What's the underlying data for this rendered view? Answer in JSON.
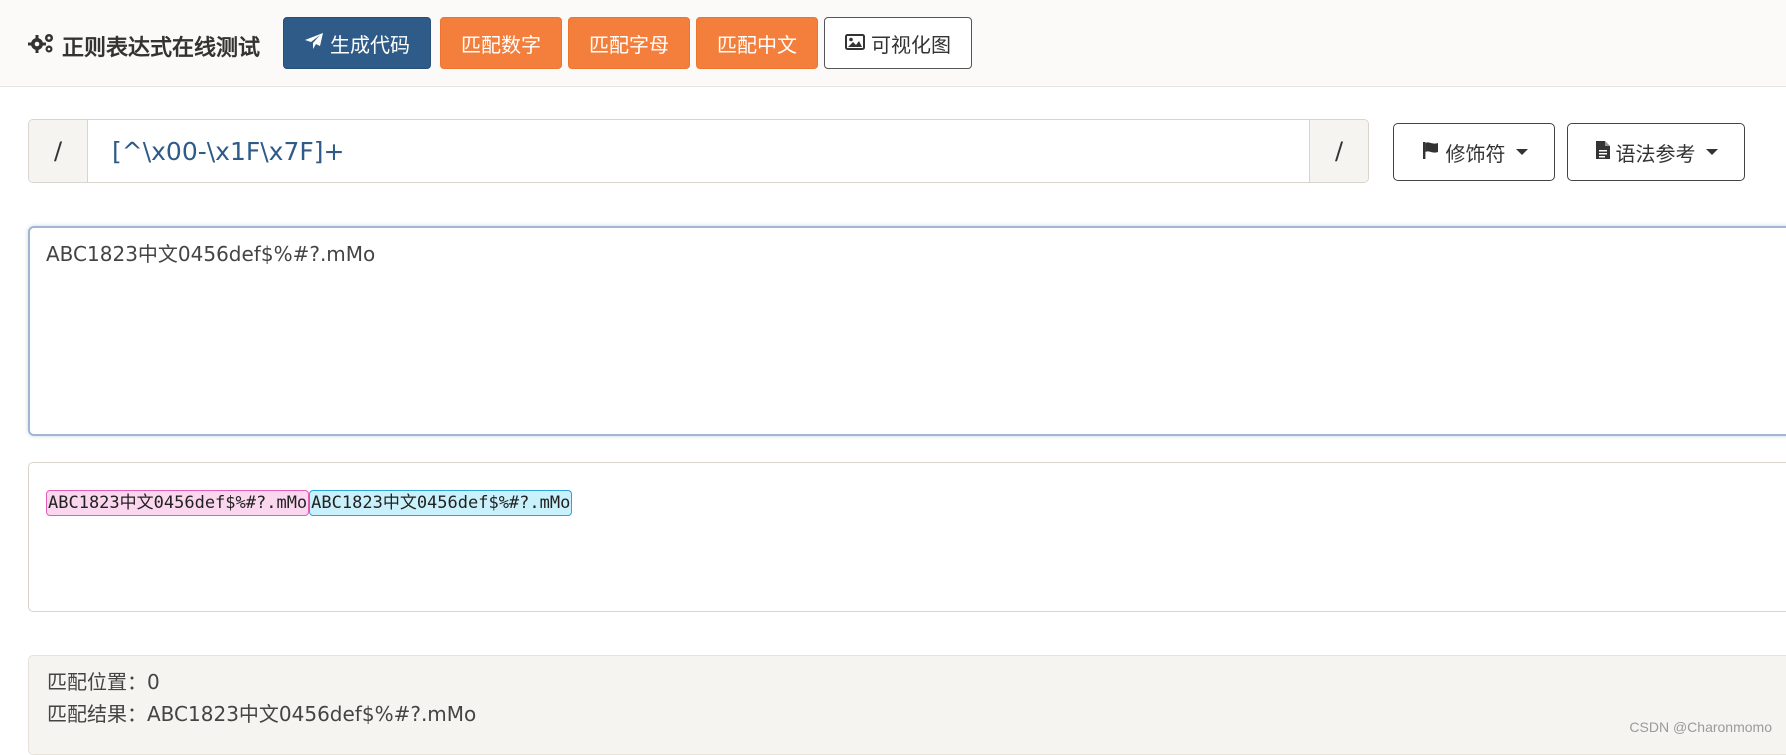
{
  "header": {
    "title": "正则表达式在线测试",
    "buttons": {
      "generate_code": "生成代码",
      "match_digits": "匹配数字",
      "match_letters": "匹配字母",
      "match_chinese": "匹配中文",
      "visualize": "可视化图"
    }
  },
  "regex": {
    "open_delimiter": "/",
    "pattern": "[^\\x00-\\x1F\\x7F]+",
    "close_delimiter": "/",
    "modifiers_label": "修饰符",
    "syntax_reference_label": "语法参考"
  },
  "test_string": "ABC1823中文0456def$%#?.mMo",
  "matches": [
    {
      "text": "ABC1823中文0456def$%#?.mMo",
      "color": "pink"
    },
    {
      "text": "ABC1823中文0456def$%#?.mMo",
      "color": "blue"
    }
  ],
  "result": {
    "position_label": "匹配位置：",
    "position_value": "0",
    "result_label": "匹配结果：",
    "result_value": "ABC1823中文0456def$%#?.mMo"
  },
  "watermark": "CSDN @Charonmomo",
  "colors": {
    "primary": "#2e5b88",
    "orange": "#f47f3c",
    "match_pink": "#fbd7ef",
    "match_blue": "#c9f1fb"
  }
}
